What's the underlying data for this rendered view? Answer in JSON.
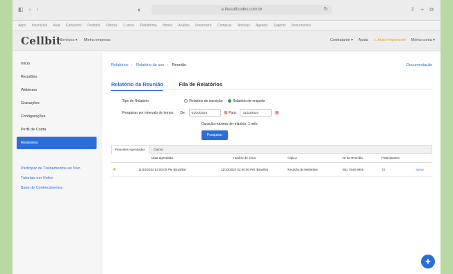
{
  "browser": {
    "nav_icons": [
      "◧",
      "‹",
      "›"
    ],
    "shield_icon": "◐",
    "url": "a.thesoftcodes.com.br",
    "reload_icon": "↻",
    "right_icons": [
      "⇪",
      "+",
      "⧉"
    ],
    "bookmarks": [
      "Apps",
      "Inscrições",
      "Aula",
      "Cadastros",
      "Pedidos",
      "Ofertas",
      "Cursos",
      "Plataforma",
      "Banco",
      "Análise",
      "Financeiro",
      "Compras",
      "Notícias",
      "Agenda",
      "Suporte",
      "Documentos"
    ]
  },
  "header": {
    "logo": "Cellbit",
    "menu": [
      "Serviços ▾",
      "Minha empresa"
    ],
    "right": [
      "Contratante ▾",
      "Ajuda",
      "⚠ Aviso importante",
      "Minha conta ▾"
    ]
  },
  "sidebar": {
    "items": [
      {
        "label": "Início"
      },
      {
        "label": "Reuniões"
      },
      {
        "label": "Webinars"
      },
      {
        "label": "Gravações"
      },
      {
        "label": "Configurações"
      },
      {
        "label": "Perfil de Conta"
      },
      {
        "label": "Relatórios"
      }
    ],
    "active_index": 6,
    "links": [
      "Participar de Treinamentos ao Vivo",
      "Tutoriais em Vídeo",
      "Base de Conhecimentos"
    ]
  },
  "main": {
    "breadcrumb": [
      "Relatórios",
      "Relatório de uso",
      "Reunião"
    ],
    "top_link": "Documentação",
    "tabs": [
      "Relatório da Reunião",
      "Fila de Relatórios"
    ],
    "form": {
      "type_label": "Tipo de Relatório:",
      "radio1": "Relatório de inscrição",
      "radio2": "Relatório de enquete",
      "search_label": "Pesquisar por intervalo de tempo:",
      "from_label": "De:",
      "from_value": "01/10/2024",
      "to_label": "Para:",
      "to_value": "31/10/2024",
      "hint": "Duração máxima de relatório: 1 mês",
      "search_button": "Pesquisar"
    },
    "results": {
      "tabs": [
        "Reuniões Agendadas",
        "Outros"
      ],
      "columns": [
        "Data agendada",
        "Horário de início",
        "Tópico",
        "ID da Reunião",
        "Participantes",
        ""
      ],
      "rows": [
        {
          "star": "★",
          "scheduled": "11/10/2024 02:00:00 PM (Brasília)",
          "start": "11/10/2024 02:00:00 PM (Brasília)",
          "topic": "Reunião de Webinário",
          "meeting_id": "861 7548 9956",
          "participants": "72",
          "action": "Gerar"
        }
      ]
    }
  },
  "fab_icon": "✚"
}
